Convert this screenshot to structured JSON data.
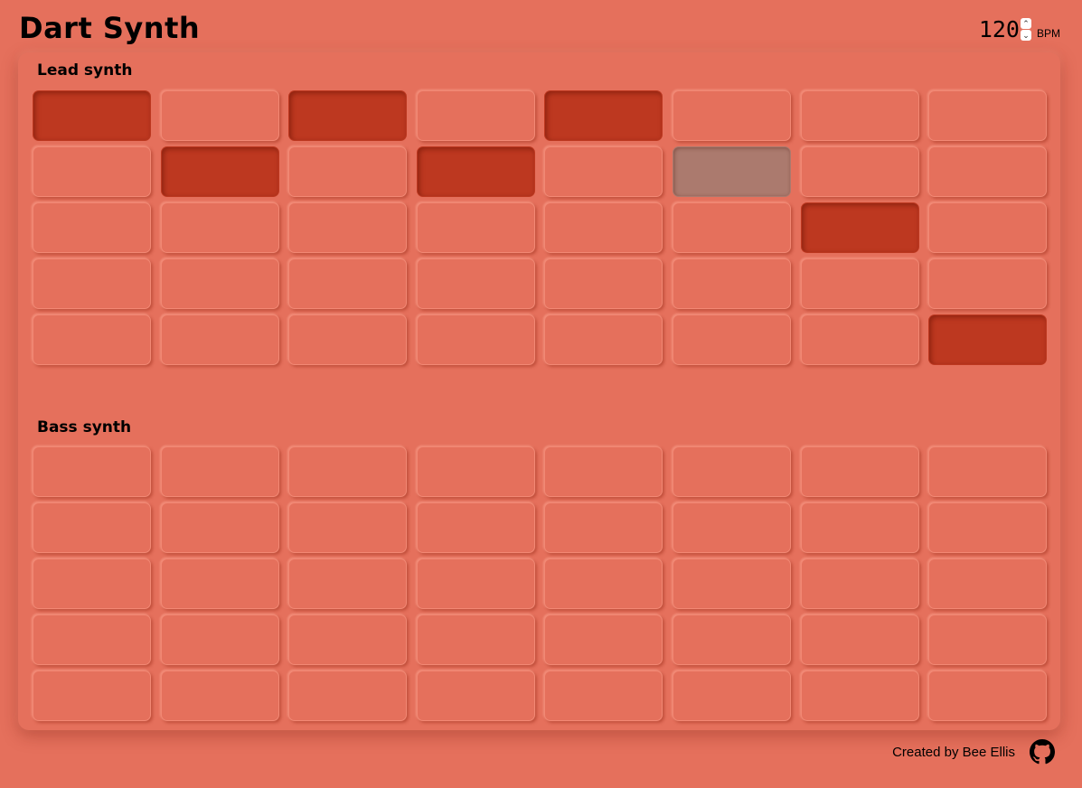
{
  "title": "Dart Synth",
  "bpm": {
    "value": "120",
    "label": "BPM",
    "up": "⌃",
    "down": "⌄"
  },
  "colors": {
    "background": "#e5705c",
    "active": "#bd3820",
    "playhead": "#ab7a6e"
  },
  "sections": [
    {
      "title": "Lead synth",
      "rows": [
        [
          1,
          0,
          1,
          0,
          1,
          0,
          0,
          0
        ],
        [
          0,
          1,
          0,
          1,
          0,
          2,
          0,
          0
        ],
        [
          0,
          0,
          0,
          0,
          0,
          0,
          1,
          0
        ],
        [
          0,
          0,
          0,
          0,
          0,
          0,
          0,
          0
        ],
        [
          0,
          0,
          0,
          0,
          0,
          0,
          0,
          1
        ]
      ]
    },
    {
      "title": "Bass synth",
      "rows": [
        [
          0,
          0,
          0,
          0,
          0,
          0,
          0,
          0
        ],
        [
          0,
          0,
          0,
          0,
          0,
          0,
          0,
          0
        ],
        [
          0,
          0,
          0,
          0,
          0,
          0,
          0,
          0
        ],
        [
          0,
          0,
          0,
          0,
          0,
          0,
          0,
          0
        ],
        [
          0,
          0,
          0,
          0,
          0,
          0,
          0,
          0
        ]
      ]
    }
  ],
  "footer": {
    "credit": "Created by Bee Ellis",
    "icon": "github-icon"
  }
}
